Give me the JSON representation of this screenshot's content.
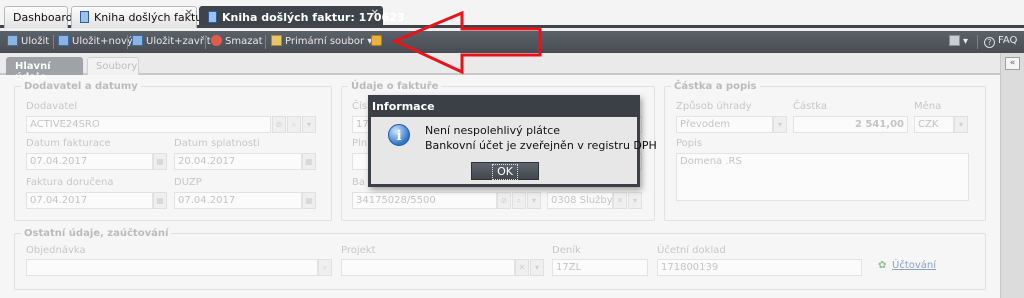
{
  "tabs": [
    {
      "label": "Dashboard"
    },
    {
      "label": "Kniha došlých faktur"
    },
    {
      "label": "Kniha došlých faktur: 170623"
    }
  ],
  "toolbar": {
    "save": "Uložit",
    "save_new": "Uložit+nový",
    "save_close": "Uložit+zavřít",
    "delete": "Smazat",
    "primary_file": "Primární soubor",
    "faq": "FAQ"
  },
  "subtabs": {
    "main": "Hlavní údaje",
    "files": "Soubory"
  },
  "dodavatel": {
    "legend": "Dodavatel a datumy",
    "dodavatel_label": "Dodavatel",
    "dodavatel_value": "ACTIVE24SRO",
    "datum_fakturace_label": "Datum fakturace",
    "datum_fakturace_value": "07.04.2017",
    "datum_splatnosti_label": "Datum splatnosti",
    "datum_splatnosti_value": "20.04.2017",
    "faktura_dorucena_label": "Faktura doručena",
    "faktura_dorucena_value": "07.04.2017",
    "duzp_label": "DUZP",
    "duzp_value": "07.04.2017"
  },
  "udaje": {
    "legend": "Údaje o faktuře",
    "field1_label": "Čísl",
    "field1_value": "17",
    "field2_label": "Pln",
    "bank_label": "Ba",
    "bank_value": "34175028/5500",
    "sluzby_value": "0308 Služby"
  },
  "castka": {
    "legend": "Částka a popis",
    "zpusob_label": "Způsob úhrady",
    "zpusob_value": "Převodem",
    "castka_label": "Částka",
    "castka_value": "2 541,00",
    "mena_label": "Měna",
    "mena_value": "CZK",
    "popis_label": "Popis",
    "popis_value": "Domena .RS"
  },
  "ostatni": {
    "legend": "Ostatní údaje, zaúčtování",
    "objednavka_label": "Objednávka",
    "projekt_label": "Projekt",
    "denik_label": "Deník",
    "denik_value": "17ZL",
    "doklad_label": "Účetní doklad",
    "doklad_value": "171800139",
    "uctovani_link": "Účtování"
  },
  "dialog": {
    "title": "Informace",
    "line1": "Není nespolehlivý plátce",
    "line2": "Bankovní účet je zveřejněn v registru DPH",
    "ok": "OK"
  },
  "colors": {
    "arrow": "#e8141b",
    "tab_active": "#3e444a"
  }
}
